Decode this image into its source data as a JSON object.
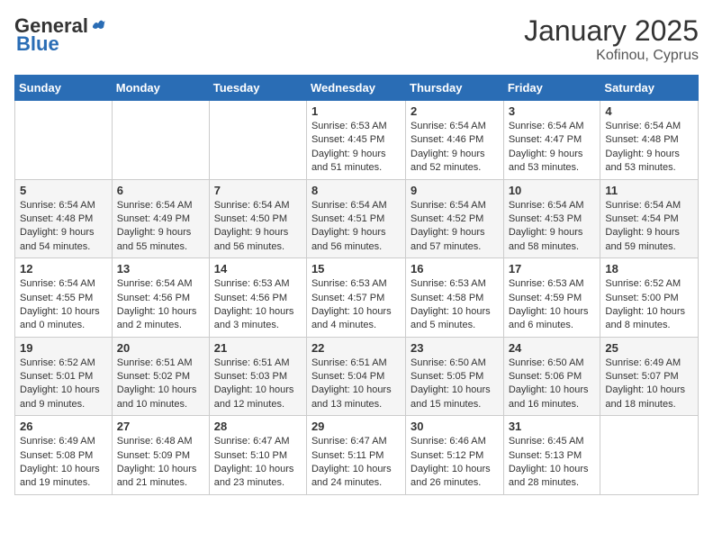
{
  "header": {
    "logo_general": "General",
    "logo_blue": "Blue",
    "month_title": "January 2025",
    "location": "Kofinou, Cyprus"
  },
  "days_of_week": [
    "Sunday",
    "Monday",
    "Tuesday",
    "Wednesday",
    "Thursday",
    "Friday",
    "Saturday"
  ],
  "weeks": [
    [
      {
        "day": "",
        "info": ""
      },
      {
        "day": "",
        "info": ""
      },
      {
        "day": "",
        "info": ""
      },
      {
        "day": "1",
        "info": "Sunrise: 6:53 AM\nSunset: 4:45 PM\nDaylight: 9 hours\nand 51 minutes."
      },
      {
        "day": "2",
        "info": "Sunrise: 6:54 AM\nSunset: 4:46 PM\nDaylight: 9 hours\nand 52 minutes."
      },
      {
        "day": "3",
        "info": "Sunrise: 6:54 AM\nSunset: 4:47 PM\nDaylight: 9 hours\nand 53 minutes."
      },
      {
        "day": "4",
        "info": "Sunrise: 6:54 AM\nSunset: 4:48 PM\nDaylight: 9 hours\nand 53 minutes."
      }
    ],
    [
      {
        "day": "5",
        "info": "Sunrise: 6:54 AM\nSunset: 4:48 PM\nDaylight: 9 hours\nand 54 minutes."
      },
      {
        "day": "6",
        "info": "Sunrise: 6:54 AM\nSunset: 4:49 PM\nDaylight: 9 hours\nand 55 minutes."
      },
      {
        "day": "7",
        "info": "Sunrise: 6:54 AM\nSunset: 4:50 PM\nDaylight: 9 hours\nand 56 minutes."
      },
      {
        "day": "8",
        "info": "Sunrise: 6:54 AM\nSunset: 4:51 PM\nDaylight: 9 hours\nand 56 minutes."
      },
      {
        "day": "9",
        "info": "Sunrise: 6:54 AM\nSunset: 4:52 PM\nDaylight: 9 hours\nand 57 minutes."
      },
      {
        "day": "10",
        "info": "Sunrise: 6:54 AM\nSunset: 4:53 PM\nDaylight: 9 hours\nand 58 minutes."
      },
      {
        "day": "11",
        "info": "Sunrise: 6:54 AM\nSunset: 4:54 PM\nDaylight: 9 hours\nand 59 minutes."
      }
    ],
    [
      {
        "day": "12",
        "info": "Sunrise: 6:54 AM\nSunset: 4:55 PM\nDaylight: 10 hours\nand 0 minutes."
      },
      {
        "day": "13",
        "info": "Sunrise: 6:54 AM\nSunset: 4:56 PM\nDaylight: 10 hours\nand 2 minutes."
      },
      {
        "day": "14",
        "info": "Sunrise: 6:53 AM\nSunset: 4:56 PM\nDaylight: 10 hours\nand 3 minutes."
      },
      {
        "day": "15",
        "info": "Sunrise: 6:53 AM\nSunset: 4:57 PM\nDaylight: 10 hours\nand 4 minutes."
      },
      {
        "day": "16",
        "info": "Sunrise: 6:53 AM\nSunset: 4:58 PM\nDaylight: 10 hours\nand 5 minutes."
      },
      {
        "day": "17",
        "info": "Sunrise: 6:53 AM\nSunset: 4:59 PM\nDaylight: 10 hours\nand 6 minutes."
      },
      {
        "day": "18",
        "info": "Sunrise: 6:52 AM\nSunset: 5:00 PM\nDaylight: 10 hours\nand 8 minutes."
      }
    ],
    [
      {
        "day": "19",
        "info": "Sunrise: 6:52 AM\nSunset: 5:01 PM\nDaylight: 10 hours\nand 9 minutes."
      },
      {
        "day": "20",
        "info": "Sunrise: 6:51 AM\nSunset: 5:02 PM\nDaylight: 10 hours\nand 10 minutes."
      },
      {
        "day": "21",
        "info": "Sunrise: 6:51 AM\nSunset: 5:03 PM\nDaylight: 10 hours\nand 12 minutes."
      },
      {
        "day": "22",
        "info": "Sunrise: 6:51 AM\nSunset: 5:04 PM\nDaylight: 10 hours\nand 13 minutes."
      },
      {
        "day": "23",
        "info": "Sunrise: 6:50 AM\nSunset: 5:05 PM\nDaylight: 10 hours\nand 15 minutes."
      },
      {
        "day": "24",
        "info": "Sunrise: 6:50 AM\nSunset: 5:06 PM\nDaylight: 10 hours\nand 16 minutes."
      },
      {
        "day": "25",
        "info": "Sunrise: 6:49 AM\nSunset: 5:07 PM\nDaylight: 10 hours\nand 18 minutes."
      }
    ],
    [
      {
        "day": "26",
        "info": "Sunrise: 6:49 AM\nSunset: 5:08 PM\nDaylight: 10 hours\nand 19 minutes."
      },
      {
        "day": "27",
        "info": "Sunrise: 6:48 AM\nSunset: 5:09 PM\nDaylight: 10 hours\nand 21 minutes."
      },
      {
        "day": "28",
        "info": "Sunrise: 6:47 AM\nSunset: 5:10 PM\nDaylight: 10 hours\nand 23 minutes."
      },
      {
        "day": "29",
        "info": "Sunrise: 6:47 AM\nSunset: 5:11 PM\nDaylight: 10 hours\nand 24 minutes."
      },
      {
        "day": "30",
        "info": "Sunrise: 6:46 AM\nSunset: 5:12 PM\nDaylight: 10 hours\nand 26 minutes."
      },
      {
        "day": "31",
        "info": "Sunrise: 6:45 AM\nSunset: 5:13 PM\nDaylight: 10 hours\nand 28 minutes."
      },
      {
        "day": "",
        "info": ""
      }
    ]
  ]
}
